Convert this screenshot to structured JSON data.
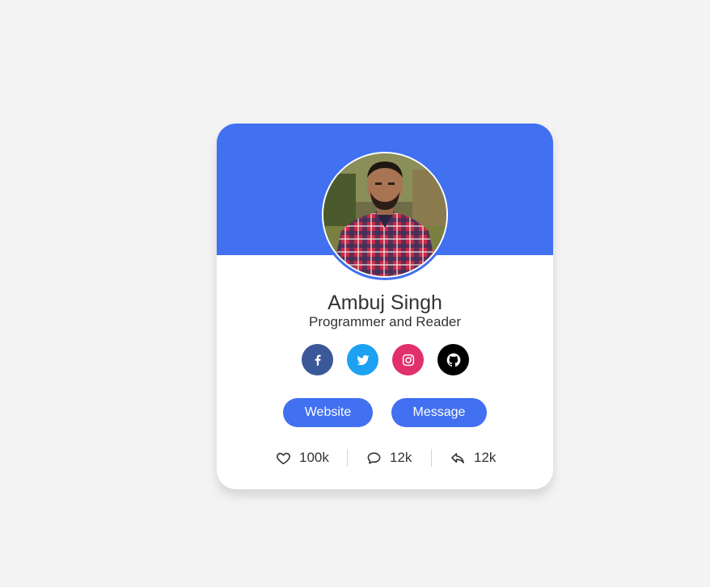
{
  "colors": {
    "accent": "#4170f1",
    "page_bg": "#f3f3f3",
    "facebook": "#3b5998",
    "twitter": "#1da1f2",
    "instagram": "#e1306c",
    "github": "#000000"
  },
  "profile": {
    "name": "Ambuj Singh",
    "role": "Programmer and Reader",
    "avatar_icon": "avatar-photo"
  },
  "social": [
    {
      "name": "facebook",
      "icon": "facebook-icon"
    },
    {
      "name": "twitter",
      "icon": "twitter-icon"
    },
    {
      "name": "instagram",
      "icon": "instagram-icon"
    },
    {
      "name": "github",
      "icon": "github-icon"
    }
  ],
  "buttons": {
    "website": "Website",
    "message": "Message"
  },
  "stats": {
    "likes": "100k",
    "comments": "12k",
    "shares": "12k"
  }
}
